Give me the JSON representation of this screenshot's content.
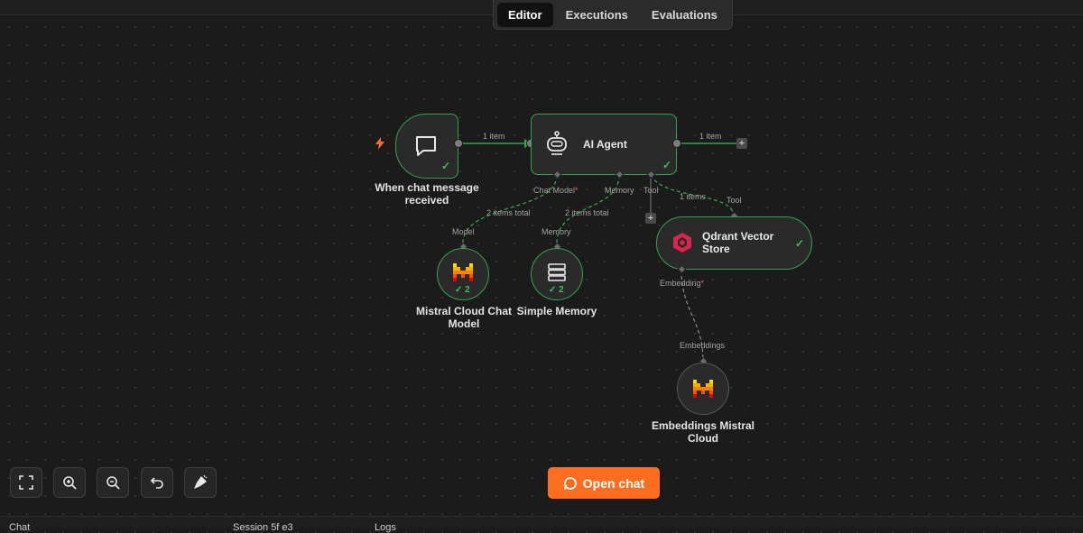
{
  "tabs": [
    {
      "label": "Editor",
      "active": true
    },
    {
      "label": "Executions",
      "active": false
    },
    {
      "label": "Evaluations",
      "active": false
    }
  ],
  "nodes": {
    "trigger": {
      "name": "When chat message received",
      "status": "success"
    },
    "agent": {
      "name": "AI Agent",
      "status": "success",
      "ports": {
        "chat_model": "Chat Model",
        "memory": "Memory",
        "tool": "Tool"
      }
    },
    "mistral_chat": {
      "name": "Mistral Cloud Chat Model",
      "runs": "2",
      "port": "Model"
    },
    "memory": {
      "name": "Simple Memory",
      "runs": "2",
      "port": "Memory"
    },
    "qdrant": {
      "name": "Qdrant Vector Store",
      "status": "success",
      "port_in": "Tool",
      "port_embed": "Embedding"
    },
    "embeddings": {
      "name": "Embeddings Mistral Cloud",
      "port": "Embeddings"
    }
  },
  "edges": {
    "trigger_agent": "1 item",
    "agent_out": "1 item",
    "chat_model": "2 items total",
    "memory": "2 items total",
    "tool": "1 items"
  },
  "controls": {
    "open_chat": "Open chat",
    "zoom_fit": "zoom-fit-icon",
    "zoom_in": "zoom-in-icon",
    "zoom_out": "zoom-out-icon",
    "undo": "undo-icon",
    "tidy": "tidy-up-icon"
  },
  "bottom": {
    "chat": "Chat",
    "session": "Session 5f e3",
    "logs": "Logs"
  },
  "colors": {
    "accent": "#ff6d1f",
    "success": "#33a34d",
    "canvas": "#1b1b1b",
    "node": "#2a2a2a",
    "qdrant": "#dc244c"
  }
}
